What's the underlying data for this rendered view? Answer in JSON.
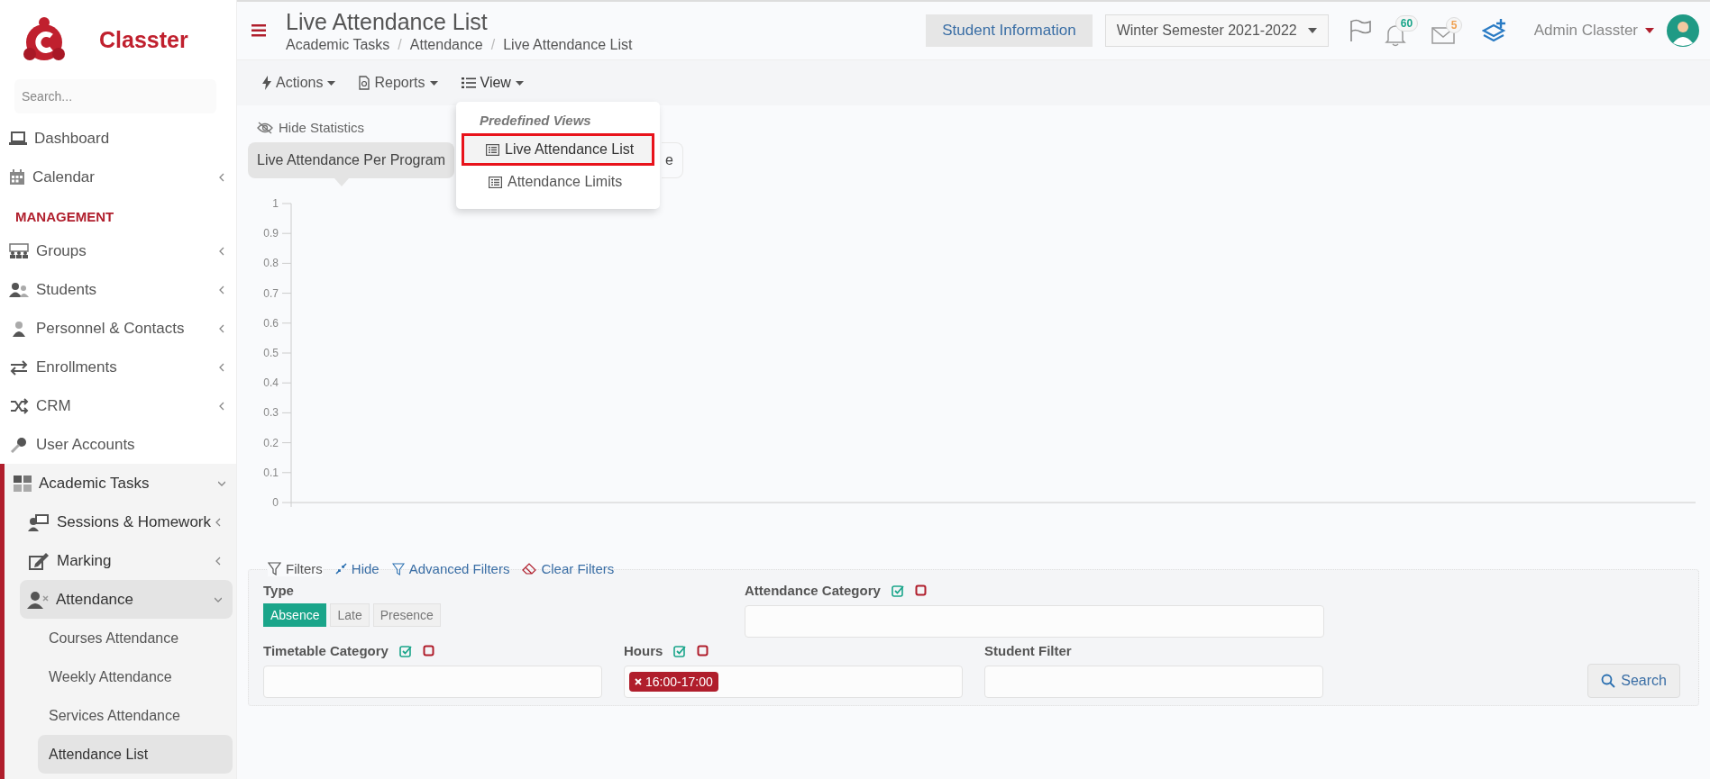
{
  "sidebar": {
    "brand": "Classter",
    "search": {
      "placeholder": "Search..."
    },
    "top_items": [
      {
        "label": "Dashboard",
        "selected": false
      },
      {
        "label": "Calendar",
        "selected": false,
        "expanded": false
      }
    ],
    "section": "MANAGEMENT",
    "items": [
      {
        "label": "Groups",
        "selected": false,
        "expanded": false
      },
      {
        "label": "Students",
        "selected": false,
        "expanded": false
      },
      {
        "label": "Personnel & Contacts",
        "selected": false,
        "expanded": false
      },
      {
        "label": "Enrollments",
        "selected": false,
        "expanded": false
      },
      {
        "label": "CRM",
        "selected": false,
        "expanded": false
      },
      {
        "label": "User Accounts",
        "selected": false
      },
      {
        "label": "Academic Tasks",
        "selected": false,
        "expanded": true,
        "children": [
          {
            "label": "Sessions & Homework",
            "selected": false,
            "expanded": false
          },
          {
            "label": "Marking",
            "selected": false,
            "expanded": false
          },
          {
            "label": "Attendance",
            "selected": false,
            "expanded": true,
            "children": [
              {
                "label": "Courses Attendance",
                "selected": false
              },
              {
                "label": "Weekly Attendance",
                "selected": false
              },
              {
                "label": "Services Attendance",
                "selected": false
              },
              {
                "label": "Attendance List",
                "selected": true
              }
            ]
          }
        ]
      }
    ]
  },
  "header": {
    "title": "Live Attendance List",
    "breadcrumb": [
      "Academic Tasks",
      "Attendance",
      "Live Attendance List"
    ],
    "breadcrumb_separator": "/",
    "student_info_button": "Student Information",
    "semester": "Winter Semester 2021-2022",
    "notifications_badge": "60",
    "messages_badge": "5",
    "user": "Admin Classter"
  },
  "toolbar": {
    "menus": [
      {
        "label": "Actions",
        "expanded": false
      },
      {
        "label": "Reports",
        "expanded": false
      },
      {
        "label": "View",
        "expanded": true
      }
    ],
    "dropdown": {
      "heading": "Predefined Views",
      "items": [
        {
          "label": "Live Attendance List",
          "selected": true
        },
        {
          "label": "Attendance Limits",
          "selected": false
        }
      ]
    }
  },
  "statistics": {
    "hide_label": "Hide Statistics",
    "tabs": [
      {
        "label": "Live Attendance Per Program",
        "selected": true
      },
      {
        "label": "e",
        "selected": false
      }
    ],
    "y_axis_labels": [
      "1",
      "0.9",
      "0.8",
      "0.7",
      "0.6",
      "0.5",
      "0.4",
      "0.3",
      "0.2",
      "0.1",
      "0"
    ]
  },
  "filters": {
    "legend": "Filters",
    "actions": [
      "Hide",
      "Advanced Filters",
      "Clear Filters"
    ],
    "type": {
      "label": "Type",
      "options": [
        {
          "label": "Absence",
          "selected": true
        },
        {
          "label": "Late",
          "selected": false
        },
        {
          "label": "Presence",
          "selected": false
        }
      ]
    },
    "attendance_category": {
      "label": "Attendance Category",
      "kind": "multi"
    },
    "fields": [
      {
        "label": "Timetable Category",
        "kind": "multi"
      },
      {
        "label": "Hours",
        "kind": "multi",
        "tokens": [
          "16:00-17:00"
        ]
      },
      {
        "label": "Student Filter",
        "kind": "text"
      }
    ],
    "search_button": "Search"
  }
}
